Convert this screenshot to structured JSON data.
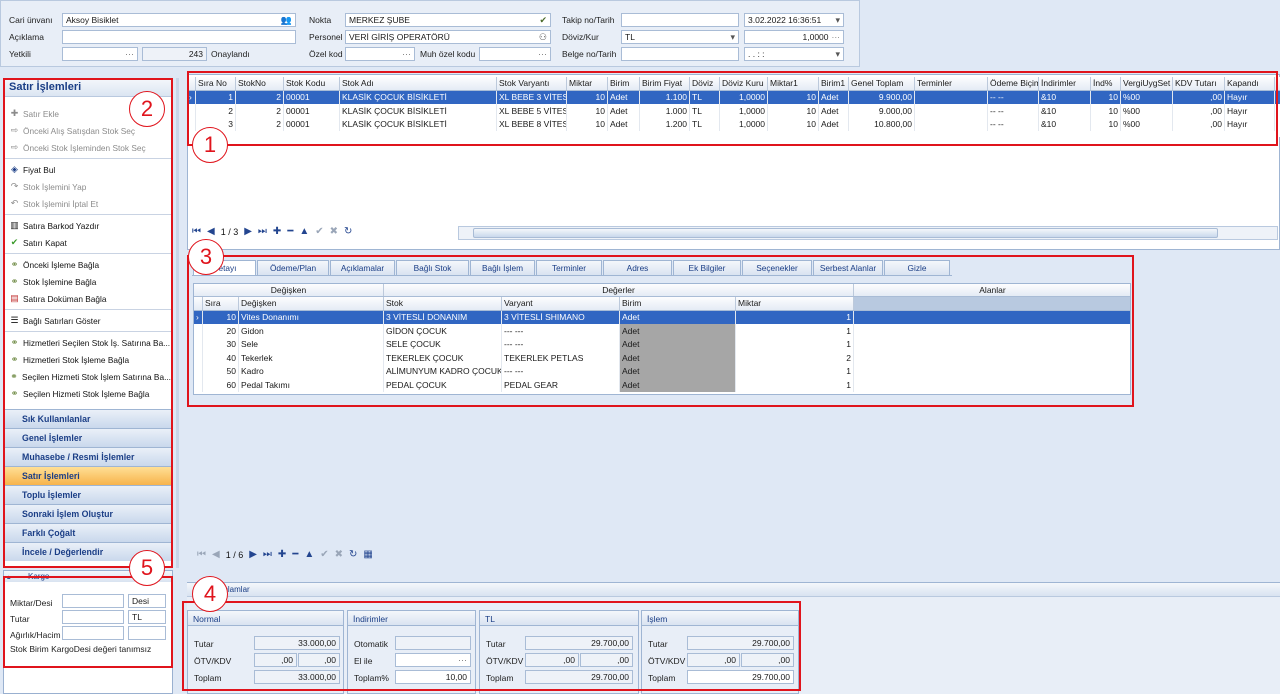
{
  "header": {
    "cari_label": "Cari ünvanı",
    "cari_value": "Aksoy Bisiklet",
    "aciklama_label": "Açıklama",
    "yetkili_label": "Yetkili",
    "yetkili_dots": "···",
    "yetkili_num": "243",
    "onay": "Onaylandı",
    "nokta_label": "Nokta",
    "nokta_value": "MERKEZ ŞUBE",
    "personel_label": "Personel",
    "personel_value": "VERİ GİRİŞ OPERATÖRÜ",
    "ozel_label": "Özel kod",
    "muh_label": "Muh özel kodu",
    "takip_label": "Takip no/Tarih",
    "takip_date": "3.02.2022 16:36:51",
    "doviz_label": "Döviz/Kur",
    "doviz_value": "TL",
    "kur_value": "1,0000",
    "belge_label": "Belge no/Tarih",
    "belge_date": ". .   : :"
  },
  "left": {
    "title": "Satır İşlemleri",
    "items": [
      {
        "label": "Satır Ekle",
        "dis": true
      },
      {
        "label": "Önceki Alış Satışdan Stok Seç",
        "dis": true
      },
      {
        "label": "Önceki Stok İşleminden Stok Seç",
        "dis": true
      },
      {
        "label": "Fiyat Bul",
        "dis": false
      },
      {
        "label": "Stok İşlemini Yap",
        "dis": true
      },
      {
        "label": "Stok İşlemini İptal Et",
        "dis": true
      },
      {
        "label": "Satıra Barkod Yazdır",
        "dis": false
      },
      {
        "label": "Satırı Kapat",
        "dis": false
      },
      {
        "label": "Önceki İşleme Bağla",
        "dis": false
      },
      {
        "label": "Stok İşlemine Bağla",
        "dis": false
      },
      {
        "label": "Satıra Doküman Bağla",
        "dis": false
      },
      {
        "label": "Bağlı Satırları Göster",
        "dis": false
      },
      {
        "label": "Hizmetleri Seçilen Stok İş. Satırına Ba...",
        "dis": false
      },
      {
        "label": "Hizmetleri Stok İşleme Bağla",
        "dis": false
      },
      {
        "label": "Seçilen Hizmeti Stok İşlem Satırına Ba...",
        "dis": false
      },
      {
        "label": "Seçilen Hizmeti Stok İşleme Bağla",
        "dis": false
      }
    ],
    "nav": [
      "Sık Kullanılanlar",
      "Genel İşlemler",
      "Muhasebe / Resmi İşlemler",
      "Satır İşlemleri",
      "Toplu İşlemler",
      "Sonraki İşlem Oluştur",
      "Farklı Çoğalt",
      "İncele / Değerlendir"
    ],
    "nav_active": 3
  },
  "kargo": {
    "title": "Kargo",
    "miktar": "Miktar/Desi",
    "desi": "Desi",
    "tutar": "Tutar",
    "tl": "TL",
    "agirlik": "Ağırlık/Hacim",
    "msg": "Stok Birim KargoDesi değeri tanımsız"
  },
  "grid1": {
    "headers": [
      "Sıra No",
      "StokNo",
      "Stok Kodu",
      "Stok Adı",
      "Stok Varyantı",
      "Miktar",
      "Birim",
      "Birim Fiyat",
      "Döviz",
      "Döviz Kuru",
      "Miktar1",
      "Birim1",
      "Genel Toplam",
      "Terminler",
      "Ödeme Biçimi",
      "İndirimler",
      "İnd%",
      "VergiUygSet",
      "KDV Tutarı",
      "Kapandı"
    ],
    "rows": [
      [
        "1",
        "2",
        "00001",
        "KLASİK ÇOCUK BİSİKLETİ",
        "XL BEBE 3 VİTES",
        "10",
        "Adet",
        "1.100",
        "TL",
        "1,0000",
        "10",
        "Adet",
        "9.900,00",
        "",
        "-- --",
        "&10",
        "10",
        "%00",
        ",00",
        "Hayır"
      ],
      [
        "2",
        "2",
        "00001",
        "KLASİK ÇOCUK BİSİKLETİ",
        "XL BEBE 5 VİTES",
        "10",
        "Adet",
        "1.000",
        "TL",
        "1,0000",
        "10",
        "Adet",
        "9.000,00",
        "",
        "-- --",
        "&10",
        "10",
        "%00",
        ",00",
        "Hayır"
      ],
      [
        "3",
        "2",
        "00001",
        "KLASİK ÇOCUK BİSİKLETİ",
        "XL BEBE 8 VİTES",
        "10",
        "Adet",
        "1.200",
        "TL",
        "1,0000",
        "10",
        "Adet",
        "10.800,00",
        "",
        "-- --",
        "&10",
        "10",
        "%00",
        ",00",
        "Hayır"
      ]
    ],
    "page": "1 / 3"
  },
  "tabs": [
    "Detayı",
    "Ödeme/Plan",
    "Açıklamalar",
    "Bağlı Stok",
    "Bağlı İşlem",
    "Terminler",
    "Adres",
    "Ek Bilgiler",
    "Seçenekler",
    "Serbest Alanlar",
    "Gizle"
  ],
  "grid2": {
    "band": [
      "Değişken",
      "Değerler",
      "Alanlar"
    ],
    "headers": [
      "Sıra",
      "Değişken",
      "Stok",
      "Varyant",
      "Birim",
      "Miktar"
    ],
    "rows": [
      [
        "10",
        "Vites Donanımı",
        "3 VİTESLİ DONANIM",
        "3 VİTESLİ SHIMANO",
        "Adet",
        "1"
      ],
      [
        "20",
        "Gidon",
        "GİDON ÇOCUK",
        "--- ---",
        "Adet",
        "1"
      ],
      [
        "30",
        "Sele",
        "SELE ÇOCUK",
        "--- ---",
        "Adet",
        "1"
      ],
      [
        "40",
        "Tekerlek",
        "TEKERLEK ÇOCUK",
        "TEKERLEK PETLAS",
        "Adet",
        "2"
      ],
      [
        "50",
        "Kadro",
        "ALİMUNYUM KADRO ÇOCUK",
        "--- ---",
        "Adet",
        "1"
      ],
      [
        "60",
        "Pedal Takımı",
        "PEDAL ÇOCUK",
        "PEDAL GEAR",
        "Adet",
        "1"
      ]
    ],
    "page": "1 / 6"
  },
  "totals": {
    "title": "Toplamlar",
    "normal": {
      "h": "Normal",
      "tutar_l": "Tutar",
      "tutar": "33.000,00",
      "otv_l": "ÖTV/KDV",
      "otv1": ",00",
      "otv2": ",00",
      "toplam_l": "Toplam",
      "toplam": "33.000,00"
    },
    "indirim": {
      "h": "İndirimler",
      "oto_l": "Otomatik",
      "el_l": "El ile",
      "el_dots": "···",
      "top_l": "Toplam%",
      "top": "10,00"
    },
    "tl": {
      "h": "TL",
      "tutar_l": "Tutar",
      "tutar": "29.700,00",
      "otv_l": "ÖTV/KDV",
      "otv1": ",00",
      "otv2": ",00",
      "toplam_l": "Toplam",
      "toplam": "29.700,00"
    },
    "islem": {
      "h": "İşlem",
      "tutar_l": "Tutar",
      "tutar": "29.700,00",
      "otv_l": "ÖTV/KDV",
      "otv1": ",00",
      "otv2": ",00",
      "toplam_l": "Toplam",
      "toplam": "29.700,00"
    }
  },
  "callouts": [
    "1",
    "2",
    "3",
    "4",
    "5"
  ]
}
